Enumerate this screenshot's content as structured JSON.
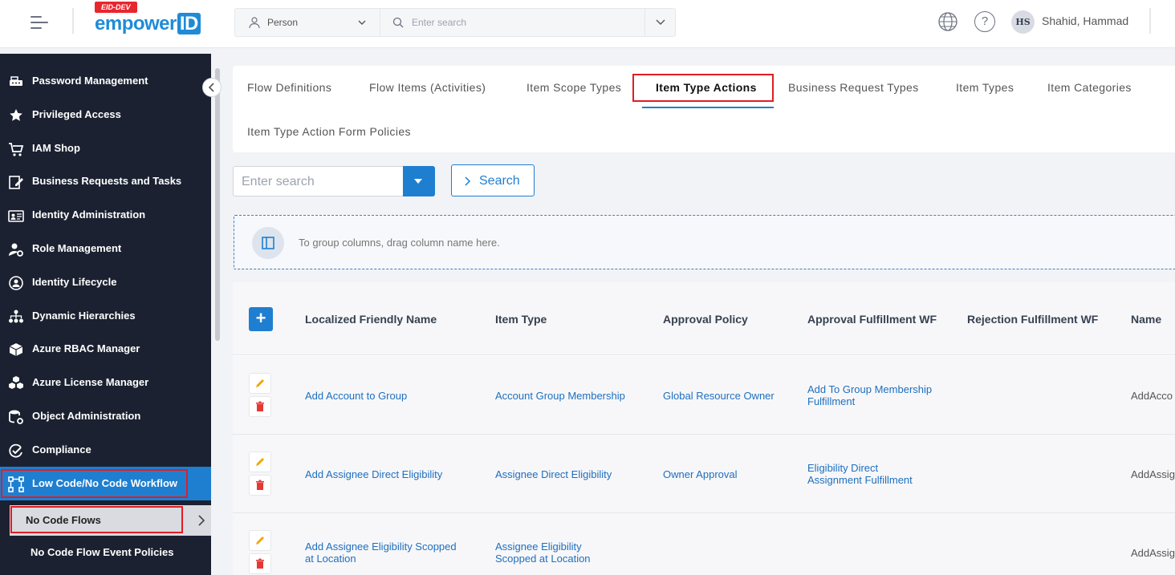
{
  "header": {
    "logo_badge": "EID-DEV",
    "logo_main": "empower",
    "logo_id": "ID",
    "search_type": "Person",
    "search_placeholder": "Enter search",
    "user_initials": "HS",
    "user_name": "Shahid, Hammad"
  },
  "sidebar": {
    "items": [
      {
        "label": "Password Management",
        "icon": "key-icon"
      },
      {
        "label": "Privileged Access",
        "icon": "star-badge-icon"
      },
      {
        "label": "IAM Shop",
        "icon": "cart-icon"
      },
      {
        "label": "Business Requests and Tasks",
        "icon": "edit-doc-icon"
      },
      {
        "label": "Identity Administration",
        "icon": "id-card-icon"
      },
      {
        "label": "Role Management",
        "icon": "user-gear-icon"
      },
      {
        "label": "Identity Lifecycle",
        "icon": "lifecycle-icon"
      },
      {
        "label": "Dynamic Hierarchies",
        "icon": "hierarchy-icon"
      },
      {
        "label": "Azure RBAC Manager",
        "icon": "cube-icon"
      },
      {
        "label": "Azure License Manager",
        "icon": "cubes-icon"
      },
      {
        "label": "Object Administration",
        "icon": "object-gear-icon"
      },
      {
        "label": "Compliance",
        "icon": "compliance-icon"
      },
      {
        "label": "Low Code/No Code Workflow",
        "icon": "workflow-icon"
      }
    ],
    "sub_items": [
      {
        "label": "No Code Flows"
      },
      {
        "label": "No Code Flow Event Policies"
      }
    ]
  },
  "tabs": [
    {
      "label": "Flow Definitions"
    },
    {
      "label": "Flow Items (Activities)"
    },
    {
      "label": "Item Scope Types"
    },
    {
      "label": "Item Type Actions"
    },
    {
      "label": "Business Request Types"
    },
    {
      "label": "Item Types"
    },
    {
      "label": "Item Categories"
    },
    {
      "label": "Item Type Action Form Policies"
    }
  ],
  "grid_search": {
    "placeholder": "Enter search",
    "button_label": "Search"
  },
  "group_panel": {
    "text": "To group columns, drag column name here."
  },
  "grid": {
    "columns": [
      "Localized Friendly Name",
      "Item Type",
      "Approval Policy",
      "Approval Fulfillment WF",
      "Rejection Fulfillment WF",
      "Name"
    ],
    "rows": [
      {
        "friendly_name": "Add Account to Group",
        "item_type": "Account Group Membership",
        "approval_policy": "Global Resource Owner",
        "approval_wf_1": "Add To Group Membership",
        "approval_wf_2": "Fulfillment",
        "name": "AddAcco"
      },
      {
        "friendly_name": "Add Assignee Direct Eligibility",
        "item_type": "Assignee Direct Eligibility",
        "approval_policy": "Owner Approval",
        "approval_wf_1": "Eligibility Direct",
        "approval_wf_2": "Assignment Fulfillment",
        "name": "AddAssig"
      },
      {
        "friendly_name_1": "Add Assignee Eligibility Scopped",
        "friendly_name_2": "at Location",
        "item_type_1": "Assignee Eligibility",
        "item_type_2": "Scopped at Location",
        "name": "AddAssig"
      }
    ]
  },
  "colors": {
    "sidebar_bg": "#1b2130",
    "accent": "#1e7fd1",
    "highlight": "#e11d25",
    "link": "#1e6fbf"
  }
}
